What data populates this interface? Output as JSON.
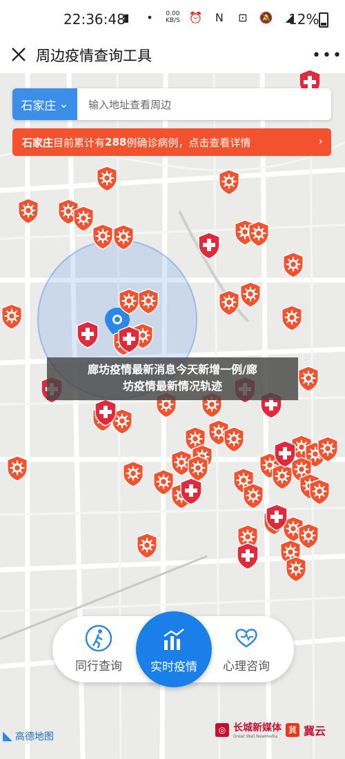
{
  "status_bar": {
    "time": "22:36:48",
    "net_speed": "0.00\nKB/S",
    "battery_pct": "12%"
  },
  "app_bar": {
    "title": "周边疫情查询工具",
    "more": "•••"
  },
  "search": {
    "city": "石家庄",
    "placeholder": "输入地址查看周边"
  },
  "banner": {
    "city": "石家庄",
    "prefix": " 目前累计有 ",
    "count": "288",
    "suffix": " 例确诊病例，点击查看详情",
    "chevron": "›"
  },
  "overlay": {
    "line1": "廊坊疫情最新消息今天新增一例/廊",
    "line2": "坊疫情最新情况轨迹"
  },
  "bottom_nav": {
    "items": [
      {
        "label": "同行查询",
        "icon": "walking-person-icon"
      },
      {
        "label": "实时疫情",
        "icon": "bar-chart-icon",
        "active": true
      },
      {
        "label": "心理咨询",
        "icon": "heart-support-icon"
      }
    ]
  },
  "footer": {
    "map_provider": "高德地图",
    "brand_left": "长城新媒体",
    "brand_left_sub": "Great Wall NewMedia",
    "brand_right": "冀云"
  },
  "colors": {
    "accent_blue": "#1a7fe8",
    "virus_red": "#f2532e",
    "hospital_red": "#e02a3b",
    "banner_red": "#f2532e"
  }
}
